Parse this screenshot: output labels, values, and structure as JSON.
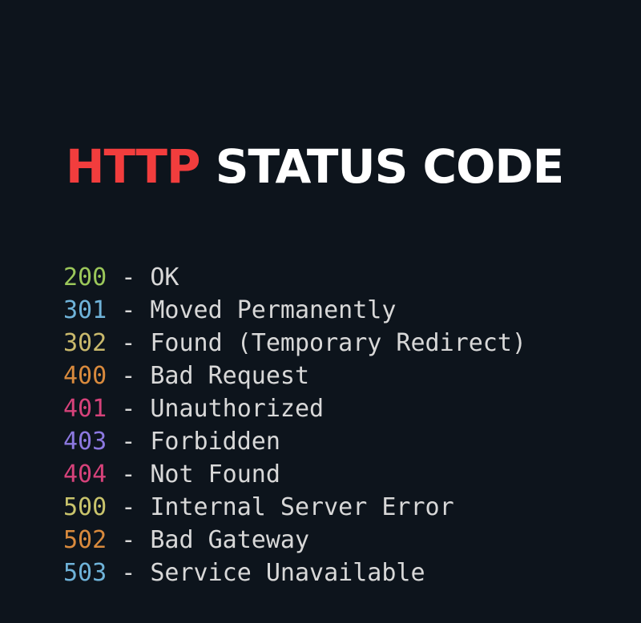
{
  "title": {
    "accent": "HTTP",
    "rest": "STATUS CODE",
    "accent_color": "#f23d3d",
    "rest_color": "#ffffff"
  },
  "background_color": "#0d141c",
  "separator": " - ",
  "codes": [
    {
      "code": "200",
      "text": "OK",
      "color": "#9bc75a"
    },
    {
      "code": "301",
      "text": "Moved Permanently",
      "color": "#6fb3d9"
    },
    {
      "code": "302",
      "text": "Found (Temporary Redirect)",
      "color": "#c9b96c"
    },
    {
      "code": "400",
      "text": "Bad Request",
      "color": "#d98a3d"
    },
    {
      "code": "401",
      "text": "Unauthorized",
      "color": "#d6427a"
    },
    {
      "code": "403",
      "text": "Forbidden",
      "color": "#8c78e0"
    },
    {
      "code": "404",
      "text": "Not Found",
      "color": "#d6427a"
    },
    {
      "code": "500",
      "text": "Internal Server Error",
      "color": "#c9c46c"
    },
    {
      "code": "502",
      "text": "Bad Gateway",
      "color": "#d98a3d"
    },
    {
      "code": "503",
      "text": "Service Unavailable",
      "color": "#6fb3d9"
    }
  ]
}
